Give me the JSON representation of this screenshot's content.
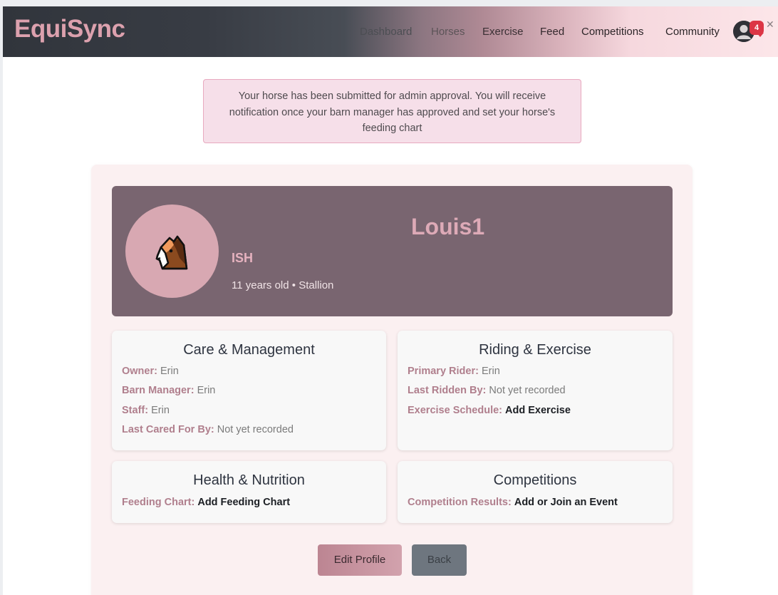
{
  "brand": "EquiSync",
  "nav": {
    "items": [
      "Dashboard",
      "Horses",
      "Exercise",
      "Feed",
      "Competitions",
      "Community"
    ],
    "notification_count": "4",
    "icons": {
      "avatar": "user-circle-icon",
      "close": "close-icon"
    }
  },
  "alert": {
    "line1": "Your horse has been submitted for admin approval. You will receive",
    "line2": "notification once your barn manager has approved and set your horse's",
    "line3": "feeding chart"
  },
  "horse": {
    "emoji": "horse-face-icon",
    "name": "Louis1",
    "breed": "ISH",
    "meta": "11 years old • Stallion"
  },
  "care": {
    "title": "Care & Management",
    "owner_label": "Owner:",
    "owner_value": "Erin",
    "barn_manager_label": "Barn Manager:",
    "barn_manager_value": "Erin",
    "staff_label": "Staff:",
    "staff_value": "Erin",
    "last_cared_label": "Last Cared For By:",
    "last_cared_value": "Not yet recorded"
  },
  "riding": {
    "title": "Riding & Exercise",
    "primary_rider_label": "Primary Rider:",
    "primary_rider_value": "Erin",
    "last_ridden_label": "Last Ridden By:",
    "last_ridden_value": "Not yet recorded",
    "schedule_label": "Exercise Schedule:",
    "schedule_link": "Add Exercise"
  },
  "health": {
    "title": "Health & Nutrition",
    "feeding_label": "Feeding Chart:",
    "feeding_link": "Add Feeding Chart"
  },
  "competitions": {
    "title": "Competitions",
    "results_label": "Competition Results:",
    "results_link": "Add or Join an Event"
  },
  "buttons": {
    "edit": "Edit Profile",
    "back": "Back"
  },
  "colors": {
    "brand": "#dca1ae",
    "hero_bg": "#796570",
    "label": "#b07f8d",
    "alert_bg": "#f6dfe9",
    "badge": "#dc3545"
  }
}
